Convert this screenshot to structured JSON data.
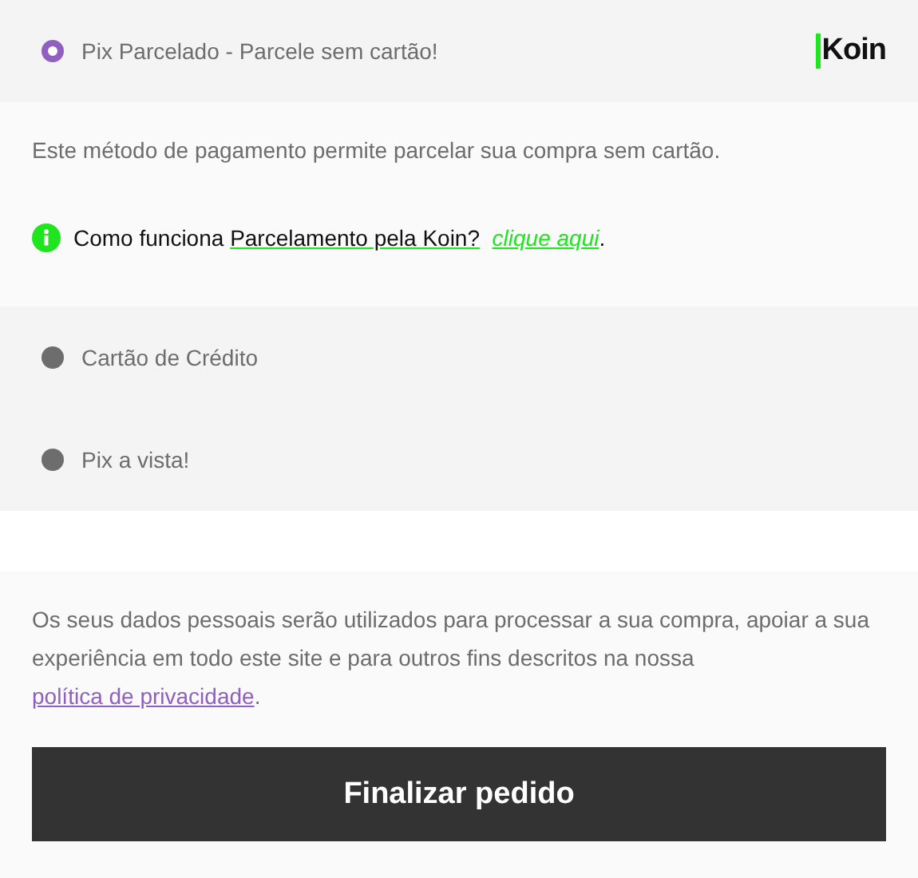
{
  "methods": [
    {
      "label": "Pix Parcelado - Parcele sem cartão!",
      "selected": true,
      "logo": "Koin"
    },
    {
      "label": "Cartão de Crédito",
      "selected": false
    },
    {
      "label": "Pix a vista!",
      "selected": false
    }
  ],
  "description": "Este método de pagamento permite parcelar sua compra sem cartão.",
  "info": {
    "text": "Como funciona ",
    "link": "Parcelamento pela Koin?",
    "action_link": "clique aqui",
    "end": "."
  },
  "privacy": {
    "text": "Os seus dados pessoais serão utilizados para processar a sua compra, apoiar a sua experiência em todo este site e para outros fins descritos na nossa ",
    "link": "política de privacidade",
    "end": "."
  },
  "submit_button": "Finalizar pedido"
}
